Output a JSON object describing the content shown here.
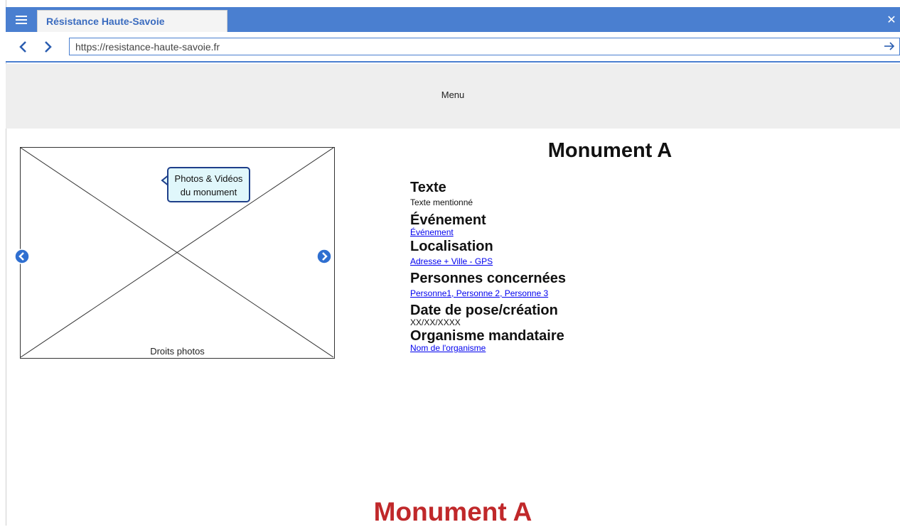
{
  "browser": {
    "tab_title": "Résistance Haute-Savoie",
    "url": "https://resistance-haute-savoie.fr"
  },
  "nav": {
    "menu_label": "Menu"
  },
  "gallery": {
    "callout_text_line1": "Photos & Vidéos",
    "callout_text_line2": "du monument",
    "credit": "Droits photos"
  },
  "monument": {
    "title": "Monument A",
    "fields": [
      {
        "label": "Texte",
        "value": "Texte mentionné",
        "is_link": false
      },
      {
        "label": "Événement",
        "value": "Événement",
        "is_link": true
      },
      {
        "label": "Localisation",
        "value": "Adresse + Ville - GPS",
        "is_link": true
      },
      {
        "label": "Personnes concernées",
        "value": "Personne1, Personne 2, Personne 3",
        "is_link": true
      },
      {
        "label": "Date de pose/création",
        "value": "XX/XX/XXXX",
        "is_link": false
      },
      {
        "label": "Organisme mandataire",
        "value": "Nom de l'organisme",
        "is_link": true
      }
    ]
  },
  "footer": {
    "title": "Monument A"
  },
  "colors": {
    "chrome_blue": "#4a7fd0",
    "link": "#0000ee",
    "bottom_title": "#c0282a"
  }
}
